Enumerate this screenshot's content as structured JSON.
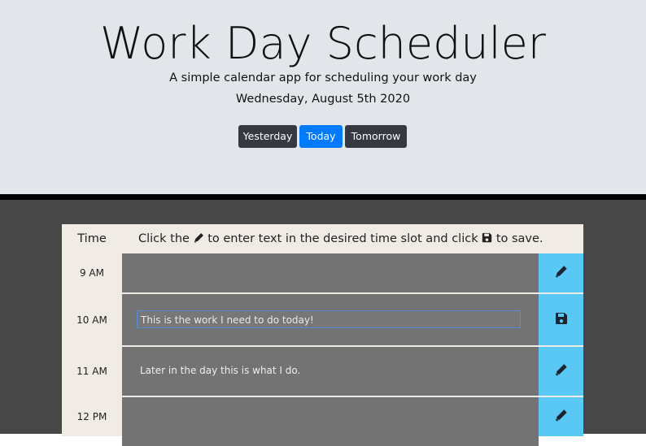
{
  "header": {
    "title": "Work Day Scheduler",
    "subtitle": "A simple calendar app for scheduling your work day",
    "date": "Wednesday, August 5th 2020",
    "buttons": {
      "yesterday": "Yesterday",
      "today": "Today",
      "tomorrow": "Tomorrow"
    }
  },
  "table": {
    "time_header": "Time",
    "instruction_part1": "Click the",
    "instruction_part2": "to enter text in the desired time slot and click",
    "instruction_part3": "to save.",
    "instruction_icons": [
      "pencil-icon",
      "save-icon"
    ],
    "rows": [
      {
        "hour": "9 AM",
        "text": "",
        "mode": "view",
        "icon": "pencil-icon"
      },
      {
        "hour": "10 AM",
        "text": "This is the work I need to do today!",
        "mode": "edit",
        "icon": "save-icon"
      },
      {
        "hour": "11 AM",
        "text": "Later in the day this is what I do.",
        "mode": "view",
        "icon": "pencil-icon"
      },
      {
        "hour": "12 PM",
        "text": "",
        "mode": "view",
        "icon": "pencil-icon"
      }
    ]
  },
  "colors": {
    "jumbotron_bg": "#e2e6ea",
    "main_bg": "#474747",
    "slot_bg": "#737373",
    "action_bg": "#5ac8f5",
    "hour_bg": "#f1ebe6",
    "today_button": "#007bff",
    "nav_button": "#343a40"
  }
}
